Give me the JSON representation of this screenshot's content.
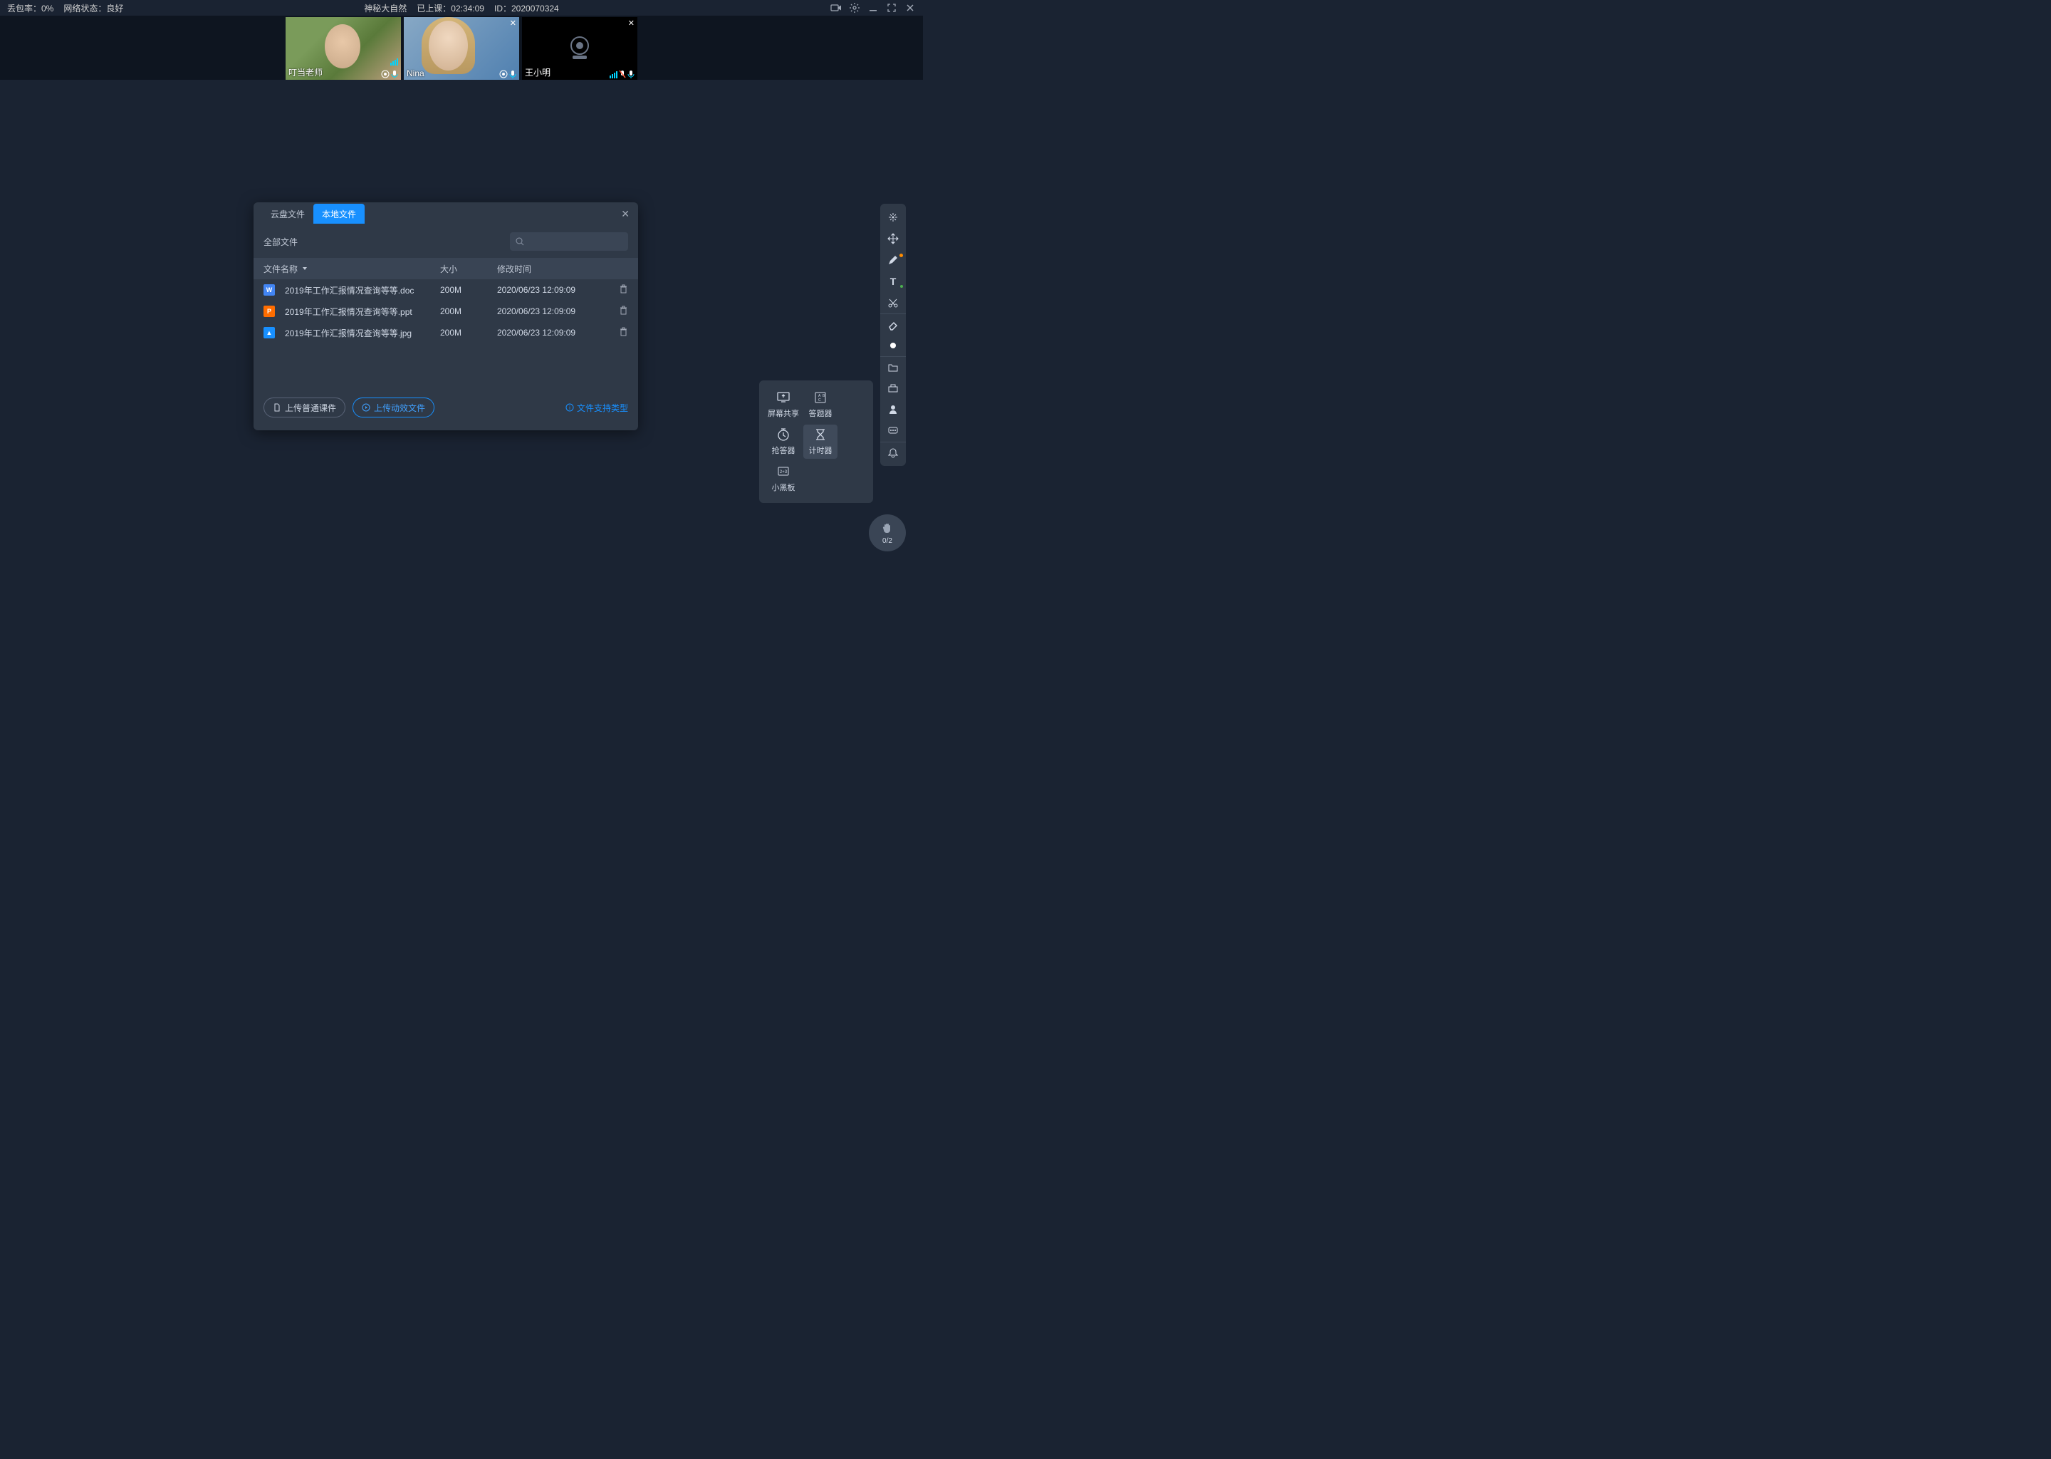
{
  "topbar": {
    "packet_loss_label": "丢包率：0%",
    "network_status_label": "网络状态：良好",
    "title": "神秘大自然",
    "class_time_label": "已上课：02:34:09",
    "id_label": "ID：2020070324"
  },
  "videos": {
    "p1": "叮当老师",
    "p2": "Nina",
    "p3": "王小明"
  },
  "dialog": {
    "tab_cloud": "云盘文件",
    "tab_local": "本地文件",
    "filter_all": "全部文件",
    "col_name": "文件名称",
    "col_size": "大小",
    "col_time": "修改时间",
    "files": [
      {
        "name": "2019年工作汇报情况查询等等.doc",
        "size": "200M",
        "time": "2020/06/23 12:09:09",
        "type": "doc"
      },
      {
        "name": "2019年工作汇报情况查询等等.ppt",
        "size": "200M",
        "time": "2020/06/23 12:09:09",
        "type": "ppt"
      },
      {
        "name": "2019年工作汇报情况查询等等.jpg",
        "size": "200M",
        "time": "2020/06/23 12:09:09",
        "type": "img"
      }
    ],
    "upload_normal": "上传普通课件",
    "upload_dynamic": "上传动效文件",
    "help_link": "文件支持类型"
  },
  "tools_popup": {
    "screen_share": "屏幕共享",
    "answer_tool": "答题器",
    "quick_answer": "抢答器",
    "timer": "计时器",
    "blackboard": "小黑板"
  },
  "raise_hand": {
    "count": "0/2"
  },
  "file_icons": {
    "doc": "W",
    "ppt": "P",
    "img": "▲"
  }
}
